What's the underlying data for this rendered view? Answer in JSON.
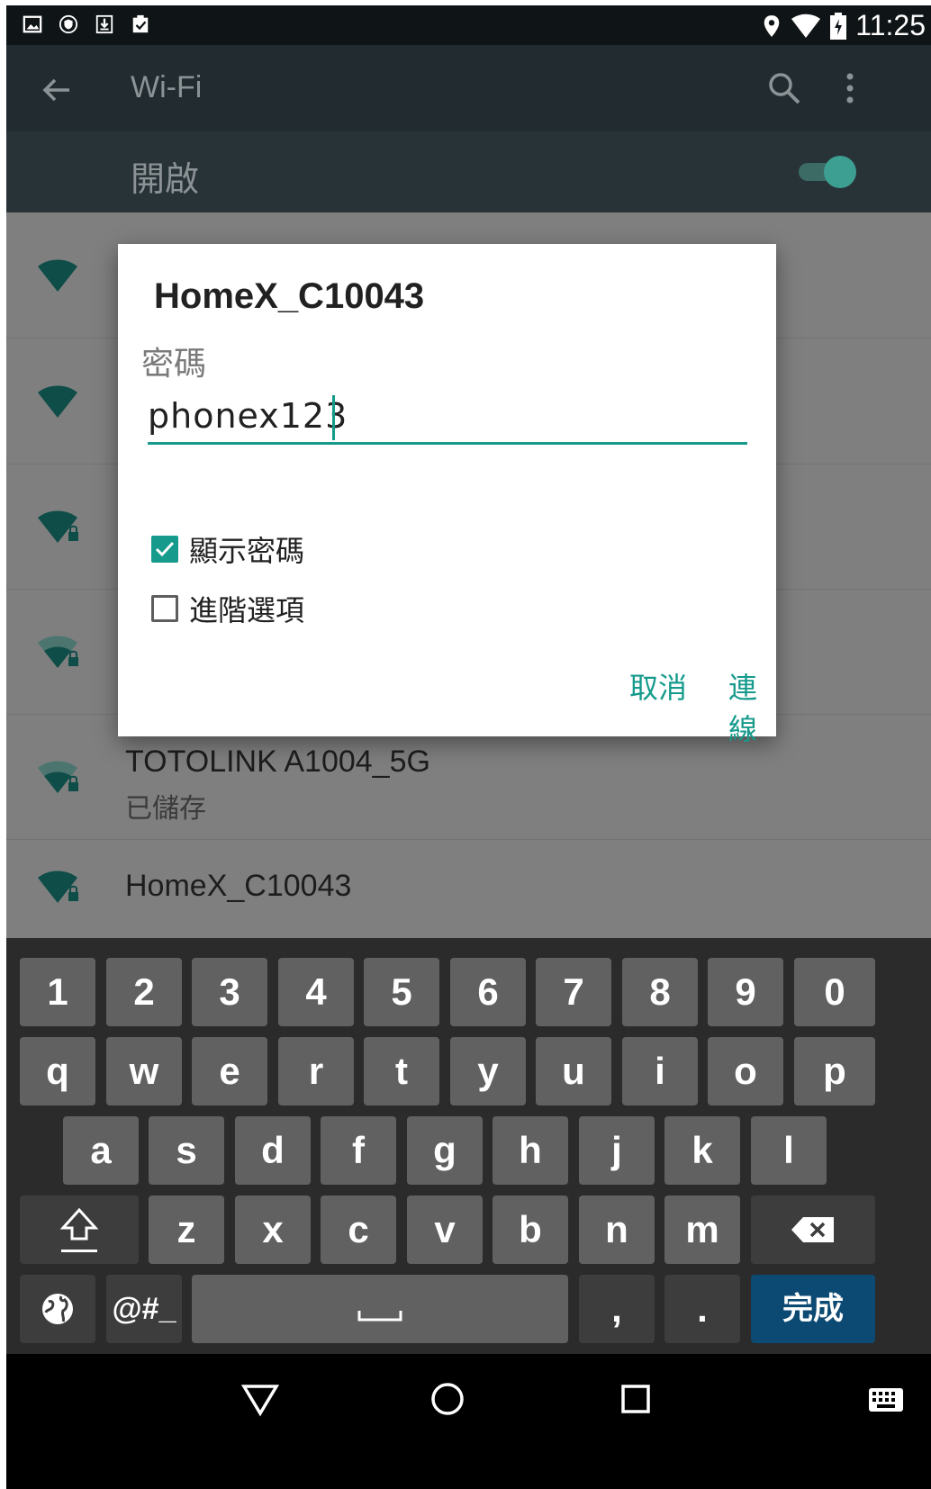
{
  "status_bar": {
    "time": "11:25",
    "left_icons": [
      "image-icon",
      "shield-icon",
      "download-icon",
      "clipboard-check-icon"
    ],
    "right_icons": [
      "location-icon",
      "wifi-icon",
      "battery-charging-icon"
    ]
  },
  "app_bar": {
    "title": "Wi-Fi",
    "icons": [
      "back-arrow-icon",
      "search-icon",
      "more-vert-icon"
    ]
  },
  "wifi_toggle": {
    "label": "開啟",
    "on": true
  },
  "network_list": [
    {
      "name": "TOTOLINK A1004_5G",
      "sub": "已儲存",
      "locked": true,
      "signal": "medium"
    },
    {
      "name": "HomeX_C10043",
      "sub": "",
      "locked": true,
      "signal": "full"
    }
  ],
  "dialog": {
    "title": "HomeX_C10043",
    "password_label": "密碼",
    "password_value": "phonex123",
    "show_password": {
      "label": "顯示密碼",
      "checked": true
    },
    "advanced_options": {
      "label": "進階選項",
      "checked": false
    },
    "cancel_label": "取消",
    "connect_label": "連線"
  },
  "keyboard": {
    "row1": [
      "1",
      "2",
      "3",
      "4",
      "5",
      "6",
      "7",
      "8",
      "9",
      "0"
    ],
    "row2": [
      "q",
      "w",
      "e",
      "r",
      "t",
      "y",
      "u",
      "i",
      "o",
      "p"
    ],
    "row3": [
      "a",
      "s",
      "d",
      "f",
      "g",
      "h",
      "j",
      "k",
      "l"
    ],
    "row4": [
      "z",
      "x",
      "c",
      "v",
      "b",
      "n",
      "m"
    ],
    "symbols_label": "@#_",
    "comma": ",",
    "period": ".",
    "done_label": "完成",
    "icons": [
      "shift-icon",
      "backspace-icon",
      "globe-icon",
      "space-bar-icon"
    ]
  },
  "nav_bar": {
    "icons": [
      "back-triangle-icon",
      "home-circle-icon",
      "recents-square-icon",
      "keyboard-icon"
    ]
  },
  "colors": {
    "accent": "#159a8c",
    "done_key": "#0d4a73",
    "scrim_list": "#7f7f7f"
  }
}
